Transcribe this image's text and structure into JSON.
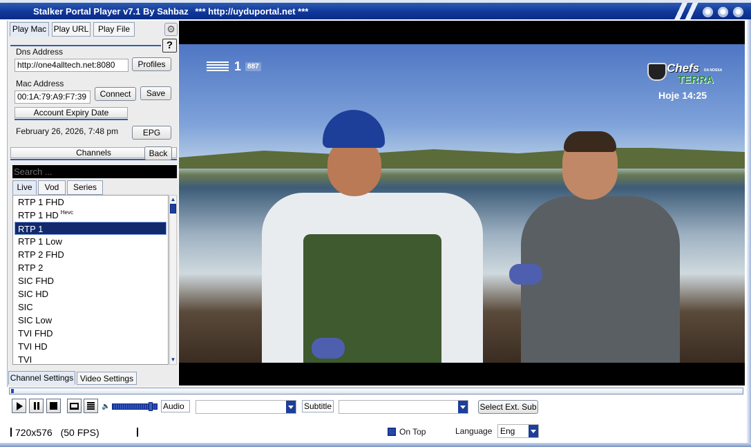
{
  "window": {
    "title": "Stalker Portal Player v7.1 By Sahbaz",
    "url_banner": "*** http://uyduportal.net ***"
  },
  "source_tabs": [
    {
      "label": "Play Mac",
      "active": true
    },
    {
      "label": "Play URL",
      "active": false
    },
    {
      "label": "Play File",
      "active": false
    }
  ],
  "help_label": "?",
  "dns": {
    "label": "Dns Address",
    "value": "http://one4alltech.net:8080",
    "profiles_button": "Profiles"
  },
  "mac": {
    "label": "Mac Address",
    "value": "00:1A:79:A9:F7:39",
    "connect_button": "Connect",
    "save_button": "Save"
  },
  "expiry": {
    "label": "Account Expiry Date",
    "value": "February 26, 2026, 7:48 pm",
    "epg_button": "EPG"
  },
  "channels": {
    "header": "Channels",
    "back_button": "Back",
    "search_placeholder": "Search ...",
    "tabs": [
      {
        "label": "Live",
        "active": true
      },
      {
        "label": "Vod",
        "active": false
      },
      {
        "label": "Series",
        "active": false
      }
    ],
    "items": [
      {
        "label": "RTP 1 FHD",
        "badge": ""
      },
      {
        "label": "RTP 1 HD",
        "badge": "Hevc"
      },
      {
        "label": "RTP 1",
        "badge": "",
        "selected": true
      },
      {
        "label": "RTP 1 Low",
        "badge": ""
      },
      {
        "label": "RTP 2 FHD",
        "badge": ""
      },
      {
        "label": "RTP 2",
        "badge": ""
      },
      {
        "label": "SIC FHD",
        "badge": ""
      },
      {
        "label": "SIC HD",
        "badge": ""
      },
      {
        "label": "SIC",
        "badge": ""
      },
      {
        "label": "SIC Low",
        "badge": ""
      },
      {
        "label": "TVI FHD",
        "badge": ""
      },
      {
        "label": "TVI HD",
        "badge": ""
      },
      {
        "label": "TVI",
        "badge": ""
      }
    ]
  },
  "settings_tabs": [
    {
      "label": "Channel Settings",
      "active": true
    },
    {
      "label": "Video Settings",
      "active": false
    }
  ],
  "video_overlay": {
    "channel_number": "1",
    "channel_code": "887",
    "brand_chefs": "Chefs",
    "brand_small": "DA NOSSA",
    "brand_terra": "TERRA",
    "time": "Hoje 14:25"
  },
  "playback": {
    "seek_fraction": 0.0,
    "volume_fraction": 0.9
  },
  "controls": {
    "audio_label": "Audio",
    "subtitle_label": "Subtitle",
    "select_ext_sub_button": "Select Ext. Sub"
  },
  "status": {
    "resolution": "720x576",
    "fps": "(50 FPS)",
    "on_top_label": "On Top",
    "on_top_checked": true,
    "language_label": "Language",
    "language_value": "Eng"
  },
  "colors": {
    "titlebar": "#10379a",
    "accent": "#1d3f99",
    "selection": "#12296e"
  }
}
